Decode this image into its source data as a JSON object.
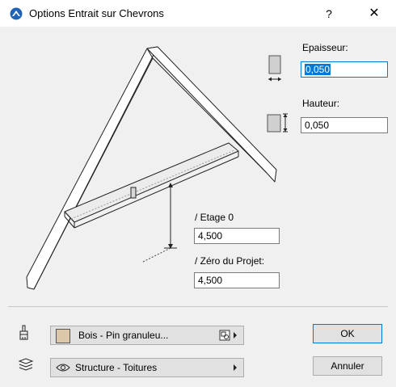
{
  "window": {
    "title": "Options Entrait sur Chevrons",
    "help_label": "?",
    "close_label": "✕",
    "app_icon": "archicad-icon"
  },
  "params": {
    "epaisseur": {
      "label": "Epaisseur:",
      "value": "0,050"
    },
    "hauteur": {
      "label": "Hauteur:",
      "value": "0,050"
    },
    "etage": {
      "label": "/ Etage 0",
      "value": "4,500"
    },
    "zero_projet": {
      "label": "/ Zéro du Projet:",
      "value": "4,500"
    }
  },
  "material": {
    "label": "Bois - Pin granuleu...",
    "swatch_color": "#dcc8a8",
    "icon": "paintbrush-icon",
    "picker_icon": "material-settings-icon"
  },
  "layer": {
    "label": "Structure - Toitures",
    "icon": "layers-icon",
    "visibility_icon": "eye-icon"
  },
  "buttons": {
    "ok": "OK",
    "cancel": "Annuler"
  },
  "colors": {
    "accent": "#0078d7",
    "dialog_bg": "#f0f0f0"
  }
}
